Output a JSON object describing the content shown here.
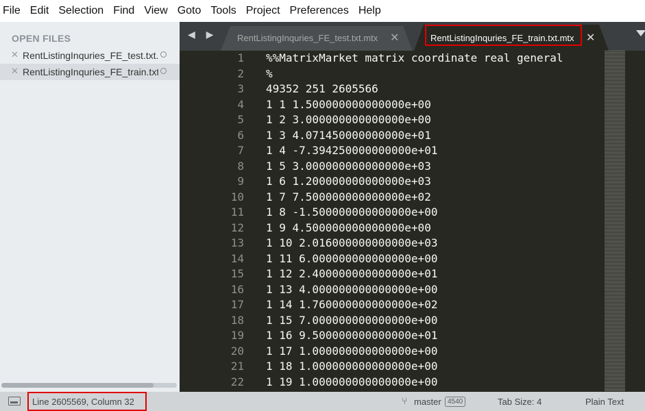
{
  "menu": [
    "File",
    "Edit",
    "Selection",
    "Find",
    "View",
    "Goto",
    "Tools",
    "Project",
    "Preferences",
    "Help"
  ],
  "sidebar": {
    "header": "OPEN FILES",
    "files": [
      {
        "name": "RentListingInquries_FE_test.txt.mtx",
        "close_glyph": "✕",
        "selected": false
      },
      {
        "name": "RentListingInquries_FE_train.txt.mtx",
        "close_glyph": "✕",
        "selected": true
      }
    ]
  },
  "tabs": [
    {
      "label": "RentListingInquries_FE_test.txt.mtx",
      "close_glyph": "✕",
      "active": false
    },
    {
      "label": "RentListingInquries_FE_train.txt.mtx",
      "close_glyph": "✕",
      "active": true
    }
  ],
  "tab_nav": "◀ ▶",
  "editor": {
    "line_numbers": [
      "1",
      "2",
      "3",
      "4",
      "5",
      "6",
      "7",
      "8",
      "9",
      "10",
      "11",
      "12",
      "13",
      "14",
      "15",
      "16",
      "17",
      "18",
      "19",
      "20",
      "21",
      "22"
    ],
    "lines": [
      "%%MatrixMarket matrix coordinate real general",
      "%",
      "49352 251 2605566",
      "1 1 1.500000000000000e+00",
      "1 2 3.000000000000000e+00",
      "1 3 4.071450000000000e+01",
      "1 4 -7.394250000000000e+01",
      "1 5 3.000000000000000e+03",
      "1 6 1.200000000000000e+03",
      "1 7 7.500000000000000e+02",
      "1 8 -1.500000000000000e+00",
      "1 9 4.500000000000000e+00",
      "1 10 2.016000000000000e+03",
      "1 11 6.000000000000000e+00",
      "1 12 2.400000000000000e+01",
      "1 13 4.000000000000000e+00",
      "1 14 1.760000000000000e+02",
      "1 15 7.000000000000000e+00",
      "1 16 9.500000000000000e+01",
      "1 17 1.000000000000000e+00",
      "1 18 1.000000000000000e+00",
      "1 19 1.000000000000000e+00"
    ]
  },
  "status": {
    "position": "Line 2605569, Column 32",
    "branch_icon": "⑂",
    "branch": "master",
    "badge": "4540",
    "tab_size": "Tab Size: 4",
    "syntax": "Plain Text"
  },
  "colors": {
    "editor_bg": "#272822",
    "highlight_box": "#e00000",
    "tabbar_bg": "#3c3f41"
  }
}
